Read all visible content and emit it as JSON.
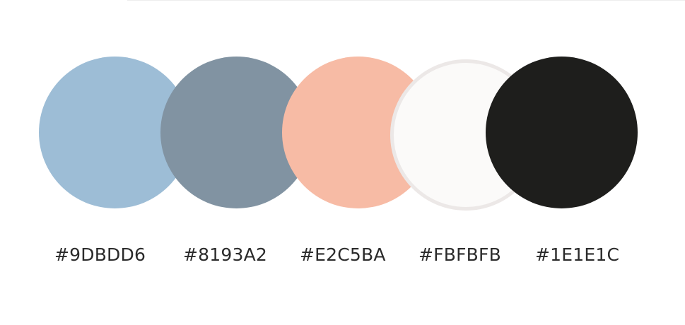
{
  "palette": {
    "swatches": [
      {
        "hex_label": "#9DBDD6",
        "fill": "#9DBDD6"
      },
      {
        "hex_label": "#8193A2",
        "fill": "#8193A2"
      },
      {
        "hex_label": "#E2C5BA",
        "fill": "#F7BBA5"
      },
      {
        "hex_label": "#FBFBFB",
        "fill": "#FBFAF9",
        "outline": "#ECE8E7"
      },
      {
        "hex_label": "#1E1E1C",
        "fill": "#1E1E1C"
      }
    ],
    "label_color": "#2B2B2B",
    "divider_color": "#EDEDED"
  }
}
